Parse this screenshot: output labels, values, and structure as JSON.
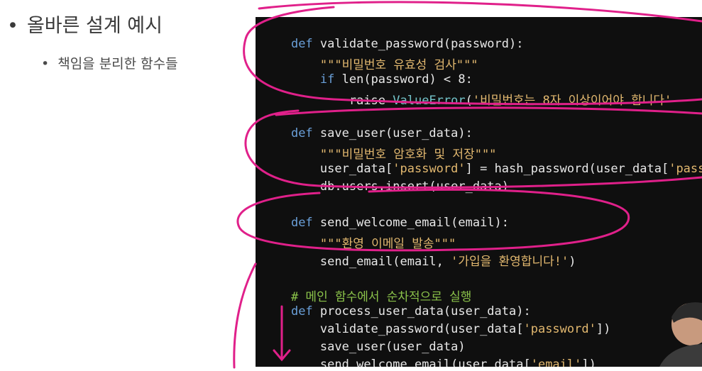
{
  "slide": {
    "bullet_main": "올바른 설계 예시",
    "bullet_sub": "책임을 분리한 함수들",
    "bullet_glyph": "•"
  },
  "code": {
    "lines": [
      {
        "kw": "def ",
        "rest": "validate_password(password):"
      },
      {
        "indent": "    ",
        "str": "\"\"\"비밀번호 유효성 검사\"\"\""
      },
      {
        "indent": "    ",
        "kw": "if ",
        "rest": "len(password) < 8:"
      },
      {
        "indent": "        ",
        "rest": "raise ",
        "cls": "ValueError",
        "rest2": "(",
        "str": "'비밀번호는 8자 이상이어야 합니다'"
      },
      {
        "kw": "def ",
        "rest": "save_user(user_data):"
      },
      {
        "indent": "    ",
        "str": "\"\"\"비밀번호 암호화 및 저장\"\"\""
      },
      {
        "indent": "    ",
        "rest": "user_data[",
        "str": "'password'",
        "rest2": "] = hash_password(user_data[",
        "str2": "'passwo"
      },
      {
        "indent": "    ",
        "rest": "db.users.insert(user_data)"
      },
      {
        "kw": "def ",
        "rest": "send_welcome_email(email):"
      },
      {
        "indent": "    ",
        "str": "\"\"\"환영 이메일 발송\"\"\""
      },
      {
        "indent": "    ",
        "rest": "send_email(email, ",
        "str": "'가입을 환영합니다!'",
        "rest2": ")"
      },
      {
        "cmt": "# 메인 함수에서 순차적으로 실행"
      },
      {
        "kw": "def ",
        "rest": "process_user_data(user_data):"
      },
      {
        "indent": "    ",
        "rest": "validate_password(user_data[",
        "str": "'password'",
        "rest2": "])"
      },
      {
        "indent": "    ",
        "rest": "save_user(user_data)"
      },
      {
        "indent": "    ",
        "rest": "send_welcome_email(user_data[",
        "str": "'email'",
        "rest2": "])"
      }
    ]
  },
  "colors": {
    "keyword": "#6a9fd8",
    "string": "#e2b86f",
    "class": "#73c3c9",
    "comment": "#8bc34a",
    "annotation": "#e0208a",
    "panel": "#0f0f0f"
  }
}
